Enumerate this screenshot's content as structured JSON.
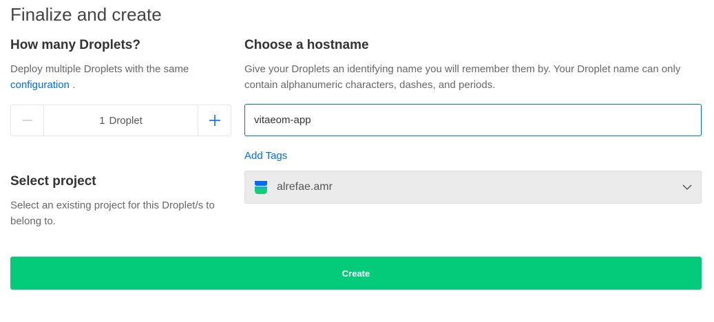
{
  "page": {
    "title": "Finalize and create"
  },
  "droplets": {
    "heading": "How many Droplets?",
    "description": "Deploy multiple Droplets with the same",
    "link_text": "configuration",
    "trailing": ".",
    "count": "1",
    "unit_label": "Droplet",
    "minus_icon": "minus-icon",
    "plus_icon": "plus-icon"
  },
  "hostname": {
    "heading": "Choose a hostname",
    "description": "Give your Droplets an identifying name you will remember them by. Your Droplet name can only contain alphanumeric characters, dashes, and periods.",
    "value": "vitaeom-app",
    "add_tags_label": "Add Tags"
  },
  "project": {
    "heading": "Select project",
    "description": "Select an existing project for this Droplet/s to belong to.",
    "selected": "alrefae.amr",
    "icon": "project-stack-icon",
    "dropdown_icon": "chevron-down-icon"
  },
  "create_button": {
    "label": "Create"
  },
  "colors": {
    "accent": "#0069ff",
    "create": "#03cb7a",
    "project_icon_top": "#0069ff",
    "project_icon_bottom": "#15cd72"
  }
}
